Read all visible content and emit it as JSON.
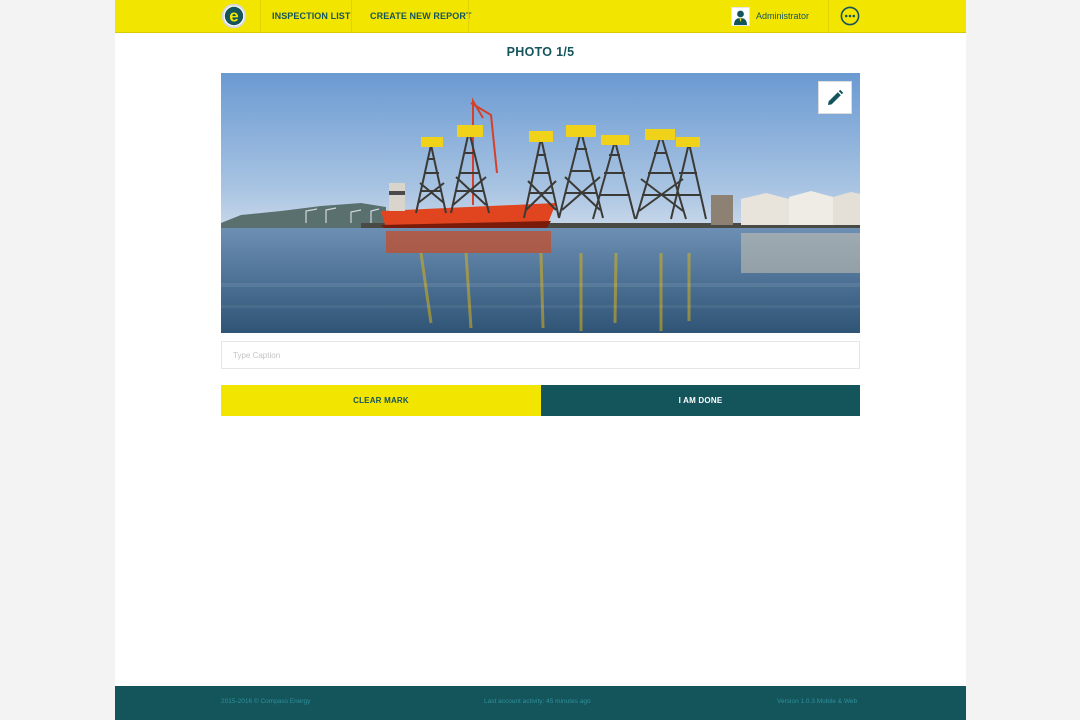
{
  "header": {
    "brand_letter": "e",
    "nav": {
      "inspection_list": "INSPECTION LIST",
      "create_new_report": "CREATE NEW REPORT"
    },
    "user": {
      "name": "Administrator"
    }
  },
  "main": {
    "title": "PHOTO 1/5",
    "caption": {
      "placeholder": "Type Caption",
      "value": ""
    },
    "buttons": {
      "clear_mark": "CLEAR MARK",
      "done": "I AM DONE"
    }
  },
  "footer": {
    "copyright": "2015-2016 © Compass Energy",
    "last_activity": "Last account activity: 45 minutes ago",
    "version": "Version 1.0.3 Mobile & Web"
  },
  "colors": {
    "brand_yellow": "#f2e500",
    "brand_teal": "#14555c",
    "footer_text": "#2e8f99",
    "page_bg": "#f3f3f3"
  },
  "icons": {
    "logo": "compass-energy-logo",
    "user": "user-avatar-icon",
    "more": "more-options-icon",
    "edit": "pencil-icon"
  }
}
